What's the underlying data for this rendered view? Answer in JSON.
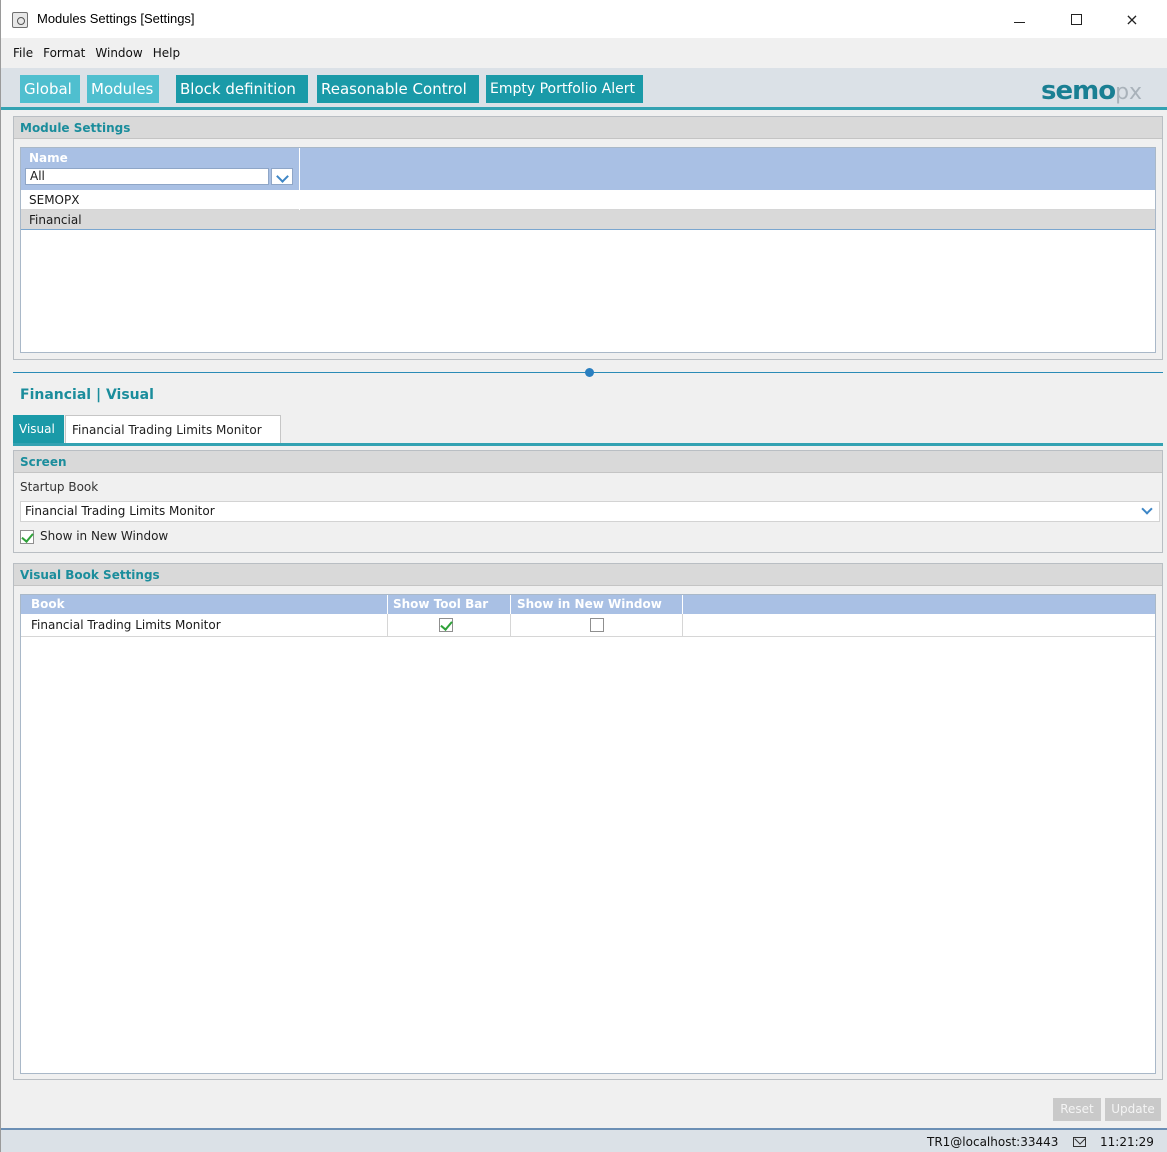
{
  "window": {
    "title": "Modules Settings [Settings]",
    "controls": {
      "minimize": "minimize",
      "maximize": "maximize",
      "close": "×"
    }
  },
  "menu": {
    "items": [
      "File",
      "Format",
      "Window",
      "Help"
    ]
  },
  "toolbar": {
    "tabs": [
      {
        "label": "Global",
        "active": true
      },
      {
        "label": "Modules",
        "active": true
      },
      {
        "label": "Block definition",
        "active": false
      },
      {
        "label": "Reasonable Control",
        "active": false
      },
      {
        "label": "Empty Portfolio Alert",
        "active": false
      }
    ],
    "logo": {
      "main": "semo",
      "suffix": "px"
    }
  },
  "module_settings": {
    "title": "Module Settings",
    "column_header": "Name",
    "filter_value": "All",
    "rows": [
      "SEMOPX",
      "Financial"
    ],
    "selected_row": "Financial"
  },
  "detail": {
    "section_title": "Financial | Visual",
    "tabs": [
      {
        "label": "Visual",
        "active": true
      },
      {
        "label": "Financial Trading Limits Monitor",
        "active": false
      }
    ]
  },
  "screen": {
    "title": "Screen",
    "startup_label": "Startup Book",
    "startup_value": "Financial Trading Limits Monitor",
    "show_in_new_window_label": "Show in New Window",
    "show_in_new_window_checked": true
  },
  "visual_book_settings": {
    "title": "Visual Book Settings",
    "columns": [
      "Book",
      "Show Tool Bar",
      "Show in New Window"
    ],
    "rows": [
      {
        "book": "Financial Trading Limits Monitor",
        "show_tool_bar": true,
        "show_in_new_window": false
      }
    ]
  },
  "footer": {
    "reset_label": "Reset",
    "update_label": "Update"
  },
  "status": {
    "connection": "TR1@localhost:33443",
    "time": "11:21:29"
  },
  "colors": {
    "accent_teal": "#1a9aa8",
    "header_blue": "#a9c0e4",
    "title_teal": "#1b8d9c"
  }
}
